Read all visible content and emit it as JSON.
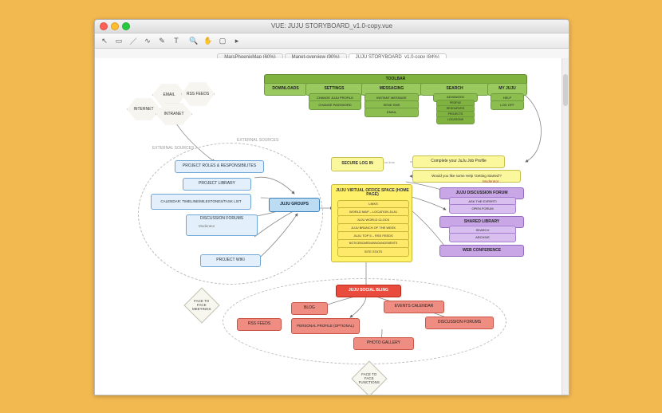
{
  "window": {
    "title": "VUE: JUJU STORYBOARD_v1.0-copy.vue"
  },
  "tabs": [
    {
      "label": "MarsPhoenixMap (60%)"
    },
    {
      "label": "Manet-overview (90%)"
    },
    {
      "label": "JUJU STORYBOARD_v1.0-copy (84%)"
    }
  ],
  "labels": {
    "ext1": "EXTERNAL SOURCES",
    "ext2": "EXTERNAL SOURCES",
    "firsttime": "1st time",
    "moderator": "Moderator",
    "moderator2": "Moderator"
  },
  "hex": {
    "internet": "INTERNET",
    "email": "EMAIL",
    "intranet": "INTRANET",
    "rss": "RSS FEEDS"
  },
  "toolbar": {
    "header": "TOOLBAR",
    "cols": {
      "downloads": "DOWNLOADS",
      "settings": "SETTINGS",
      "settings_items": [
        "CHANGE JUJU PROFILE",
        "CHANGE PASSWORD"
      ],
      "messaging": "MESSAGING",
      "messaging_items": [
        "INSTANT MESSAGE",
        "SEND SMS",
        "EMAIL"
      ],
      "search": "SEARCH",
      "search_items": [
        "ADVANCED",
        "PEOPLE",
        "RESOURCES",
        "PROJECTS",
        "LOCATIONS"
      ],
      "myjuju": "MY JUJU",
      "myjuju_items": [
        "HELP",
        "LOG OFF"
      ]
    }
  },
  "login": "SECURE LOG IN",
  "profile_prompt": "Complete your JuJu Job Profile",
  "help_prompt": "Would you like some Help 'Getting Started'?",
  "home": {
    "title": "JUJU VIRTUAL OFFICE SPACE (HOME PAGE)",
    "items": [
      "LINKS",
      "WORLD MAP – LOCATION JUJU",
      "JUJU WORLD CLOCK",
      "JUJU BRANCH OF THE WEEK",
      "JUJU TOP 5 – RSS FEEDS",
      "NOTICEBOARD/ANNOUNCEMENTS",
      "SITE STATS"
    ]
  },
  "groups": {
    "header": "JUJU GROUPS",
    "items": {
      "roles": "PROJECT ROLES & RESPONSIBILITES",
      "library": "PROJECT LIBRARY",
      "calendar": "CALENDAR: TIMELINE/MILESTONES/TASK LIST",
      "forums": "DISCUSSION FORUMS",
      "wiki": "PROJECT WIKI"
    }
  },
  "purple": {
    "discussion": "JUJU DISCUSSION FORUM",
    "discussion_items": [
      "ASK THE EXPERT!",
      "OPEN FORUM"
    ],
    "shared": "SHARED LIBRARY",
    "shared_items": [
      "SEARCH",
      "ARCHIVE"
    ],
    "webconf": "WEB CONFERENCE"
  },
  "social": {
    "header": "JUJU SOCIAL BLING",
    "items": {
      "blog": "BLOG",
      "events": "EVENTS CALENDAR",
      "rss": "RSS FEEDS",
      "profile": "PERSONAL PROFILE (OPTIONAL)",
      "forums": "DISCUSSION FORUMS",
      "gallery": "PHOTO GALLERY"
    }
  },
  "diamonds": {
    "meetings": "FACE TO FACE MEETINGS",
    "functions": "FACE TO FACE FUNCTIONS"
  }
}
